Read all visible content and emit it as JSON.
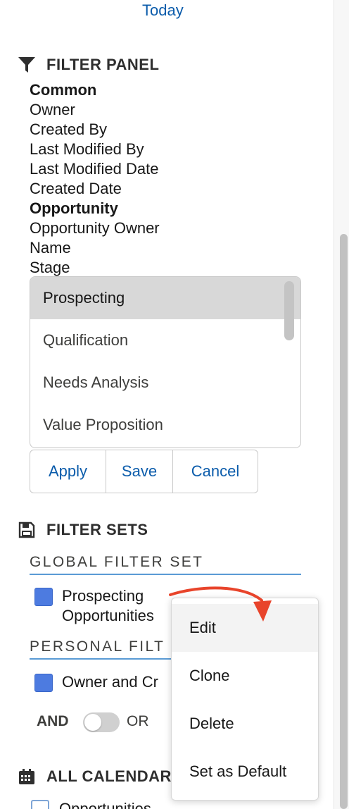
{
  "header": {
    "today_label": "Today"
  },
  "filter_panel": {
    "title": "FILTER PANEL",
    "labels": [
      {
        "text": "Common",
        "bold": true
      },
      {
        "text": "Owner",
        "bold": false
      },
      {
        "text": "Created By",
        "bold": false
      },
      {
        "text": "Last Modified By",
        "bold": false
      },
      {
        "text": "Last Modified Date",
        "bold": false
      },
      {
        "text": "Created Date",
        "bold": false
      },
      {
        "text": "Opportunity",
        "bold": true
      },
      {
        "text": "Opportunity Owner",
        "bold": false
      },
      {
        "text": "Name",
        "bold": false
      },
      {
        "text": "Stage",
        "bold": false
      }
    ],
    "stage_options": [
      "Prospecting",
      "Qualification",
      "Needs Analysis",
      "Value Proposition"
    ],
    "selected_stage": "Prospecting",
    "buttons": {
      "apply": "Apply",
      "save": "Save",
      "cancel": "Cancel"
    }
  },
  "filter_sets": {
    "title": "FILTER SETS",
    "global_heading": "GLOBAL FILTER SET",
    "global_item": {
      "line1": "Prospecting",
      "line2": "Opportunities",
      "checked": true
    },
    "personal_heading": "PERSONAL FILT",
    "personal_item": {
      "label": "Owner and Cr",
      "checked": true
    },
    "logic": {
      "and_label": "AND",
      "or_label": "OR",
      "or_enabled": false
    }
  },
  "all_calendars": {
    "title": "ALL CALENDAR",
    "first_item": {
      "label": "Opportunities",
      "checked": false
    }
  },
  "context_menu": {
    "items": [
      "Edit",
      "Clone",
      "Delete",
      "Set as Default"
    ],
    "highlighted": "Edit"
  },
  "icons": {
    "filter": "funnel-icon",
    "filter_sets": "floppy-disk-icon",
    "calendars": "calendar-icon",
    "annotation": "red-curved-arrow"
  },
  "colors": {
    "link": "#0b5cab",
    "checkbox": "#4d7be0",
    "underline": "#5a9bd5",
    "annotation_arrow": "#e8442b",
    "selected_option": "#d8d8d8"
  }
}
